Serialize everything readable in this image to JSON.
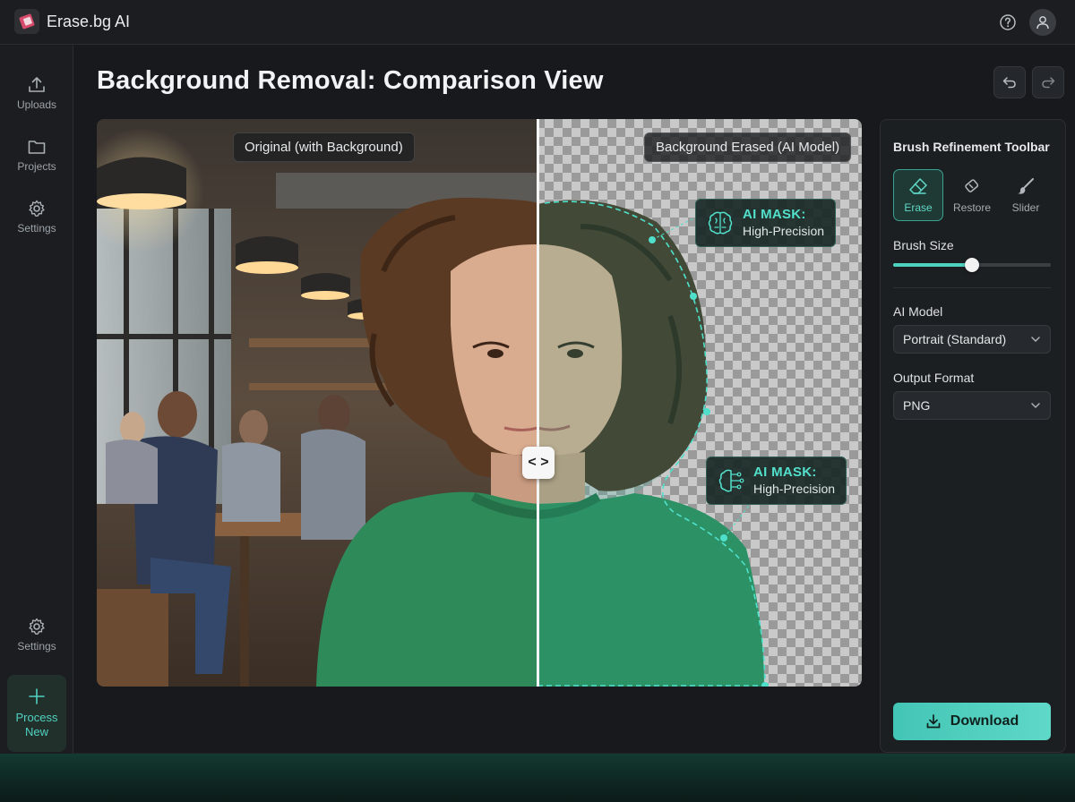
{
  "app": {
    "title": "Erase.bg AI"
  },
  "sidebar": {
    "items": [
      {
        "label": "Uploads",
        "icon": "upload-icon"
      },
      {
        "label": "Projects",
        "icon": "folder-icon"
      },
      {
        "label": "Settings",
        "icon": "gear-icon"
      }
    ],
    "bottom_settings": {
      "label": "Settings",
      "icon": "gear-icon"
    },
    "process_new": {
      "label": "Process New",
      "icon": "plus-icon"
    }
  },
  "main": {
    "title": "Background Removal: Comparison View",
    "labels": {
      "original": "Original (with Background)",
      "erased": "Background Erased (AI Model)"
    },
    "divider_handle": "< >",
    "mask_tags": [
      {
        "title": "AI MASK:",
        "subtitle": "High-Precision"
      },
      {
        "title": "AI MASK:",
        "subtitle": "High-Precision"
      }
    ]
  },
  "panel": {
    "title": "Brush Refinement Toolbar",
    "tools": [
      {
        "label": "Erase",
        "icon": "eraser-icon",
        "active": true
      },
      {
        "label": "Restore",
        "icon": "restore-eraser-icon",
        "active": false
      },
      {
        "label": "Slider",
        "icon": "brush-icon",
        "active": false
      }
    ],
    "brush_size_label": "Brush Size",
    "brush_size_value": 0.5,
    "ai_model_label": "AI Model",
    "ai_model_value": "Portrait (Standard)",
    "output_format_label": "Output Format",
    "output_format_value": "PNG",
    "download_label": "Download"
  },
  "colors": {
    "accent": "#4fd1c0",
    "background": "#17191c",
    "panel": "#1c1f22",
    "sweater": "#2f8a5a"
  }
}
